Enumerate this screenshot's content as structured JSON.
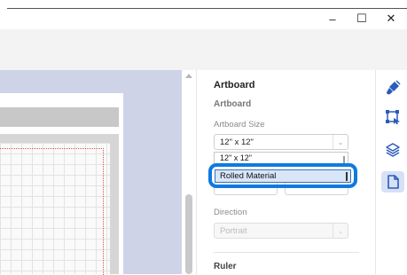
{
  "window": {
    "minimize_glyph": "–",
    "maximize_glyph": "☐",
    "close_glyph": "✕"
  },
  "panel": {
    "title": "Artboard",
    "section_title": "Artboard",
    "artboard_size_label": "Artboard Size",
    "artboard_size_value": "12\" x 12\"",
    "dropdown_options": [
      "12\" x 12\"",
      "Rolled Material"
    ],
    "highlighted_option": "Rolled Material",
    "direction_label": "Direction",
    "direction_value": "Portrait",
    "ruler_label": "Ruler"
  },
  "icons": {
    "paint": "paint-brush-icon",
    "select": "selection-icon",
    "layers": "layers-icon",
    "page": "page-icon"
  },
  "colors": {
    "accent": "#0f7ae0",
    "icon": "#2d5bb9",
    "canvas_bg": "#ced3e8",
    "active_icon_bg": "#d6e1f6"
  }
}
